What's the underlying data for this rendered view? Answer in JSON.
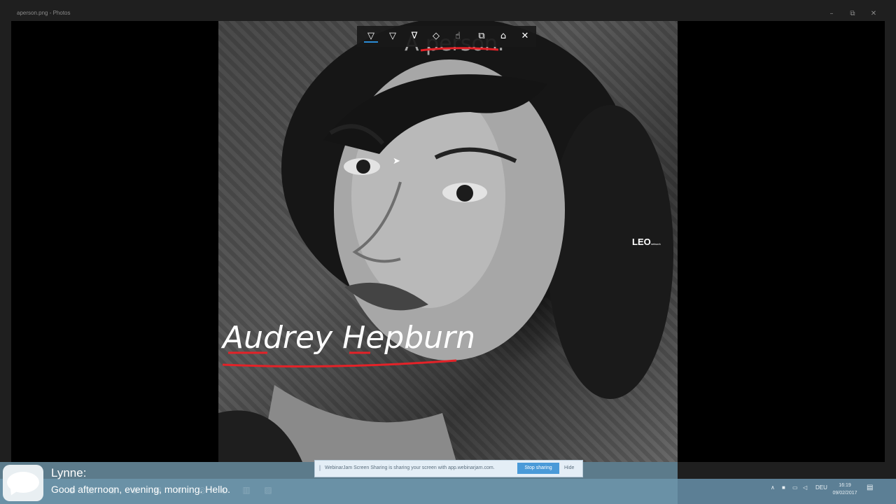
{
  "window": {
    "title": "aperson.png - Photos",
    "minimize": "–",
    "restore": "⧉",
    "close": "✕"
  },
  "photo": {
    "watermark": "LEO",
    "watermark_sub": "network"
  },
  "ink_toolbar": {
    "tools": [
      {
        "name": "ballpoint-pen",
        "glyph": "▽",
        "active": true
      },
      {
        "name": "pencil",
        "glyph": "▽"
      },
      {
        "name": "highlighter",
        "glyph": "∇"
      },
      {
        "name": "eraser",
        "glyph": "◇"
      },
      {
        "name": "touch-writing",
        "glyph": "☝"
      },
      {
        "name": "copy",
        "glyph": "⧉"
      },
      {
        "name": "clear-all",
        "glyph": "⌂"
      },
      {
        "name": "close",
        "glyph": "✕"
      }
    ]
  },
  "annotations": {
    "top_text": "A person.",
    "name_text": "Audrey Hepburn",
    "ink_colors": {
      "red": "#e32228",
      "white": "#ffffff"
    }
  },
  "chat": {
    "sender": "Lynne:",
    "message": "Good afternoon, evening, morning. Hello."
  },
  "share_bar": {
    "text": "WebinarJam Screen Sharing is sharing your screen with app.webinarjam.com.",
    "stop_label": "Stop sharing",
    "hide_label": "Hide"
  },
  "taskbar": {
    "tray": {
      "language": "DEU",
      "time": "16:19",
      "date": "09/02/2017"
    }
  },
  "colors": {
    "accent": "#2b8cd6",
    "taskbar": "#5c7f95",
    "stop_button": "#4a9ad8"
  }
}
